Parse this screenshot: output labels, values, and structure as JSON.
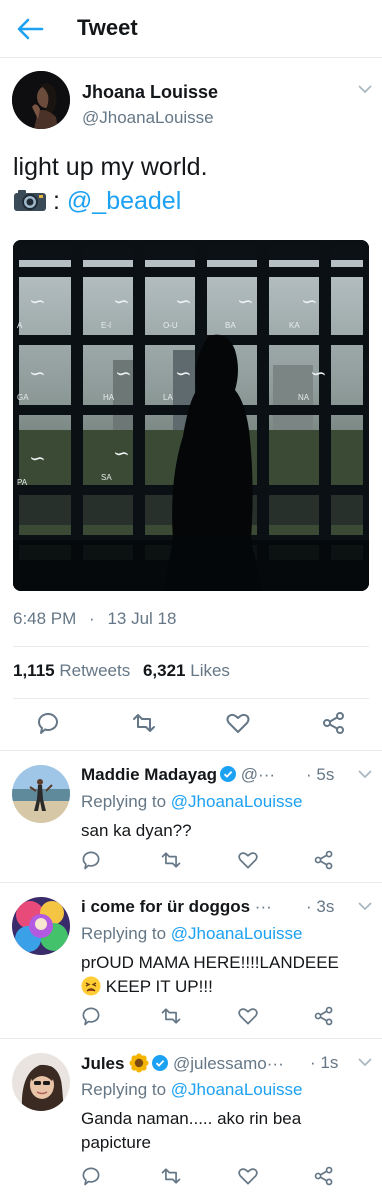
{
  "header": {
    "title": "Tweet",
    "back_icon": "arrow-left-icon",
    "accent": "#1da1f2"
  },
  "tweet": {
    "name": "Jhoana Louisse",
    "handle": "@JhoanaLouisse",
    "text_line1": "light up my world.",
    "text_sep": ":",
    "text_mention": "@_beadel",
    "camera_icon": "camera-icon",
    "time": "6:48 PM",
    "dot": "·",
    "date": "13 Jul 18",
    "retweets_count": "1,115",
    "retweets_label": "Retweets",
    "likes_count": "6,321",
    "likes_label": "Likes",
    "media_labels": [
      "E-I",
      "O-U",
      "BA",
      "KA",
      "A",
      "GA",
      "HA",
      "LA",
      "NA",
      "PA",
      "SA"
    ]
  },
  "replies": [
    {
      "name": "Maddie Madayag",
      "verified": true,
      "handle": "@···",
      "time": "5s",
      "replying_label": "Replying to",
      "replying_to": "@JhoanaLouisse",
      "text": "san ka dyan??"
    },
    {
      "name": "i come for ür doggos",
      "handle": "···",
      "time": "3s",
      "replying_label": "Replying to",
      "replying_to": "@JhoanaLouisse",
      "text_line1": "prOUD MAMA HERE!!!!LANDEEE",
      "text_line2": "KEEP IT UP!!!",
      "emoji_icon": "persevering-face-emoji"
    },
    {
      "name": "Jules",
      "verified": true,
      "handle": "@julessamo···",
      "time": "1s",
      "replying_label": "Replying to",
      "replying_to": "@JhoanaLouisse",
      "text_line1": "Ganda naman..... ako rin bea",
      "text_line2": "papicture",
      "emoji_icon": "sunflower-emoji"
    }
  ]
}
